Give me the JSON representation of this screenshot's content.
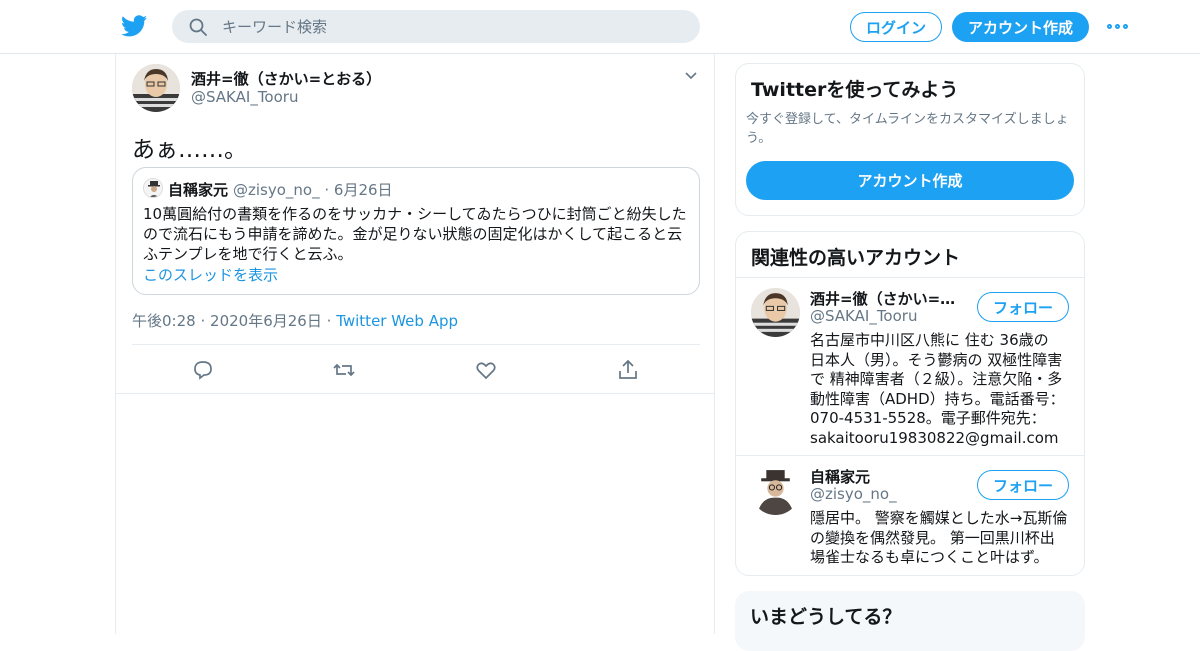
{
  "header": {
    "search_placeholder": "キーワード検索",
    "login_label": "ログイン",
    "signup_label": "アカウント作成",
    "brand_color": "#1da1f2"
  },
  "tweet": {
    "author_name": "酒井=徹（さかい=とおる）",
    "author_handle": "@SAKAI_Tooru",
    "text": "あぁ……。",
    "quote": {
      "name": "自稱家元",
      "handle": "@zisyo_no_",
      "date": "· 6月26日",
      "body": "10萬圓給付の書類を作るのをサッカナ・シーしてゐたらつひに封筒ごと紛失したので流石にもう申請を諦めた。金が足りない狀態の固定化はかくして起こると云ふテンプレを地で行くと云ふ。",
      "thread_link": "このスレッドを表示"
    },
    "meta": {
      "time": "午後0:28",
      "date": "2020年6月26日",
      "separator": "·",
      "app": "Twitter Web App"
    },
    "action_icons": [
      "reply-icon",
      "retweet-icon",
      "like-icon",
      "share-icon"
    ]
  },
  "sidebar": {
    "signup_card": {
      "title": "Twitterを使ってみよう",
      "desc": "今すぐ登録して、タイムラインをカスタマイズしましょう。",
      "button": "アカウント作成"
    },
    "related": {
      "title": "関連性の高いアカウント",
      "accounts": [
        {
          "name": "酒井=徹（さかい=とおる）",
          "handle": "@SAKAI_Tooru",
          "bio": "名古屋市中川区八熊に 住む 36歳の 日本人（男）。そう鬱病の 双極性障害で 精神障害者（２級）。注意欠陥・多動性障害（ADHD）持ち。電話番号：070-4531-5528。電子郵件宛先：sakaitooru19830822@gmail.com",
          "follow": "フォロー"
        },
        {
          "name": "自稱家元",
          "handle": "@zisyo_no_",
          "bio": "隱居中。 警察を觸媒とした水→瓦斯倫の變換を偶然發見。 第一回黒川杯出場雀士なるも卓につくこと叶はず。",
          "follow": "フォロー"
        }
      ]
    },
    "trends": {
      "title": "いまどうしてる？"
    }
  }
}
